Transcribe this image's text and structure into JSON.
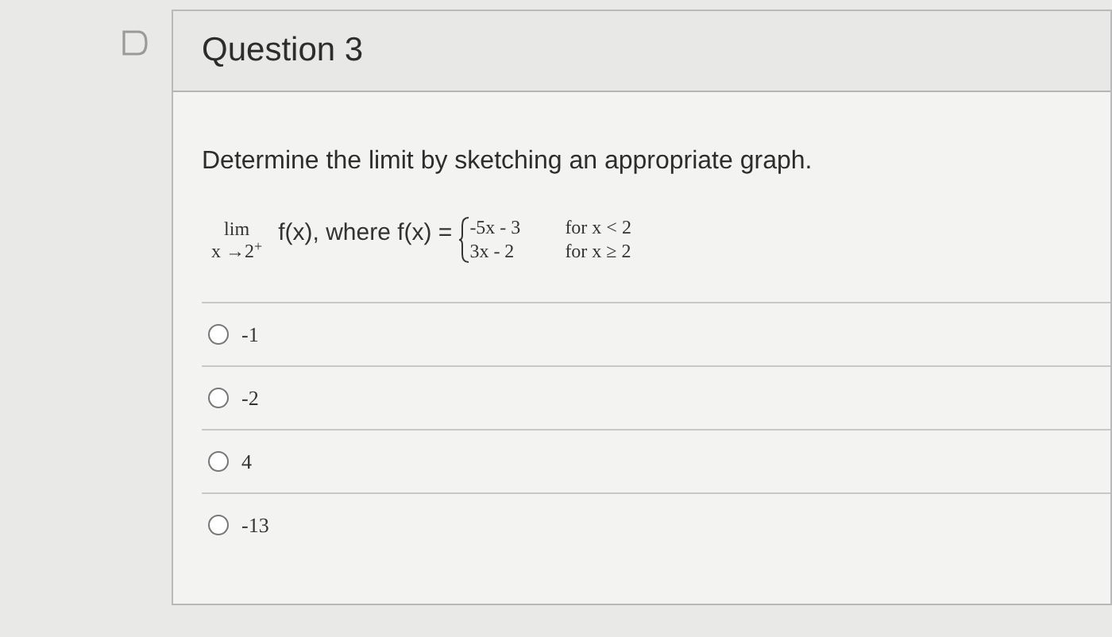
{
  "question": {
    "title": "Question 3",
    "prompt": "Determine the limit by sketching an appropriate graph.",
    "formula": {
      "lim": "lim",
      "approach": "x →2$^{+}$",
      "expression": "f(x), where f(x) =",
      "cases": [
        {
          "expr": "-5x - 3",
          "condition": "for x < 2"
        },
        {
          "expr": "3x - 2",
          "condition": "for x ≥ 2"
        }
      ]
    },
    "options": [
      {
        "label": "-1",
        "selected": false
      },
      {
        "label": "-2",
        "selected": false
      },
      {
        "label": "4",
        "selected": false
      },
      {
        "label": "-13",
        "selected": false
      }
    ]
  }
}
